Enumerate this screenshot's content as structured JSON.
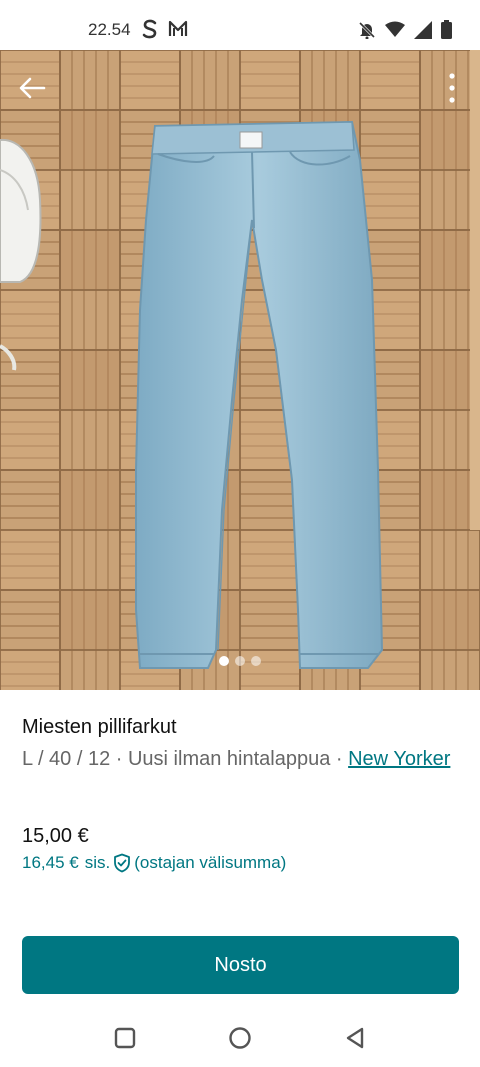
{
  "status_bar": {
    "time": "22.54",
    "icons": [
      "s-app-icon",
      "mail-icon",
      "mute-icon",
      "wifi-icon",
      "signal-icon",
      "battery-icon"
    ]
  },
  "listing": {
    "title": "Miesten pillifarkut",
    "meta_prefix": "L / 40 / 12 · Uusi ilman hintalappua · ",
    "brand": "New Yorker",
    "price": "15,00 €",
    "buyer_price": "16,45 €",
    "buyer_price_suffix": "sis.",
    "buyer_price_note": "(ostajan välisumma)"
  },
  "gallery": {
    "image_count": 3,
    "current_index": 0
  },
  "actions": {
    "buy_label": "Nosto"
  },
  "colors": {
    "accent": "#007782",
    "denim": "#8fb8cf",
    "floor": "#c9a277"
  }
}
